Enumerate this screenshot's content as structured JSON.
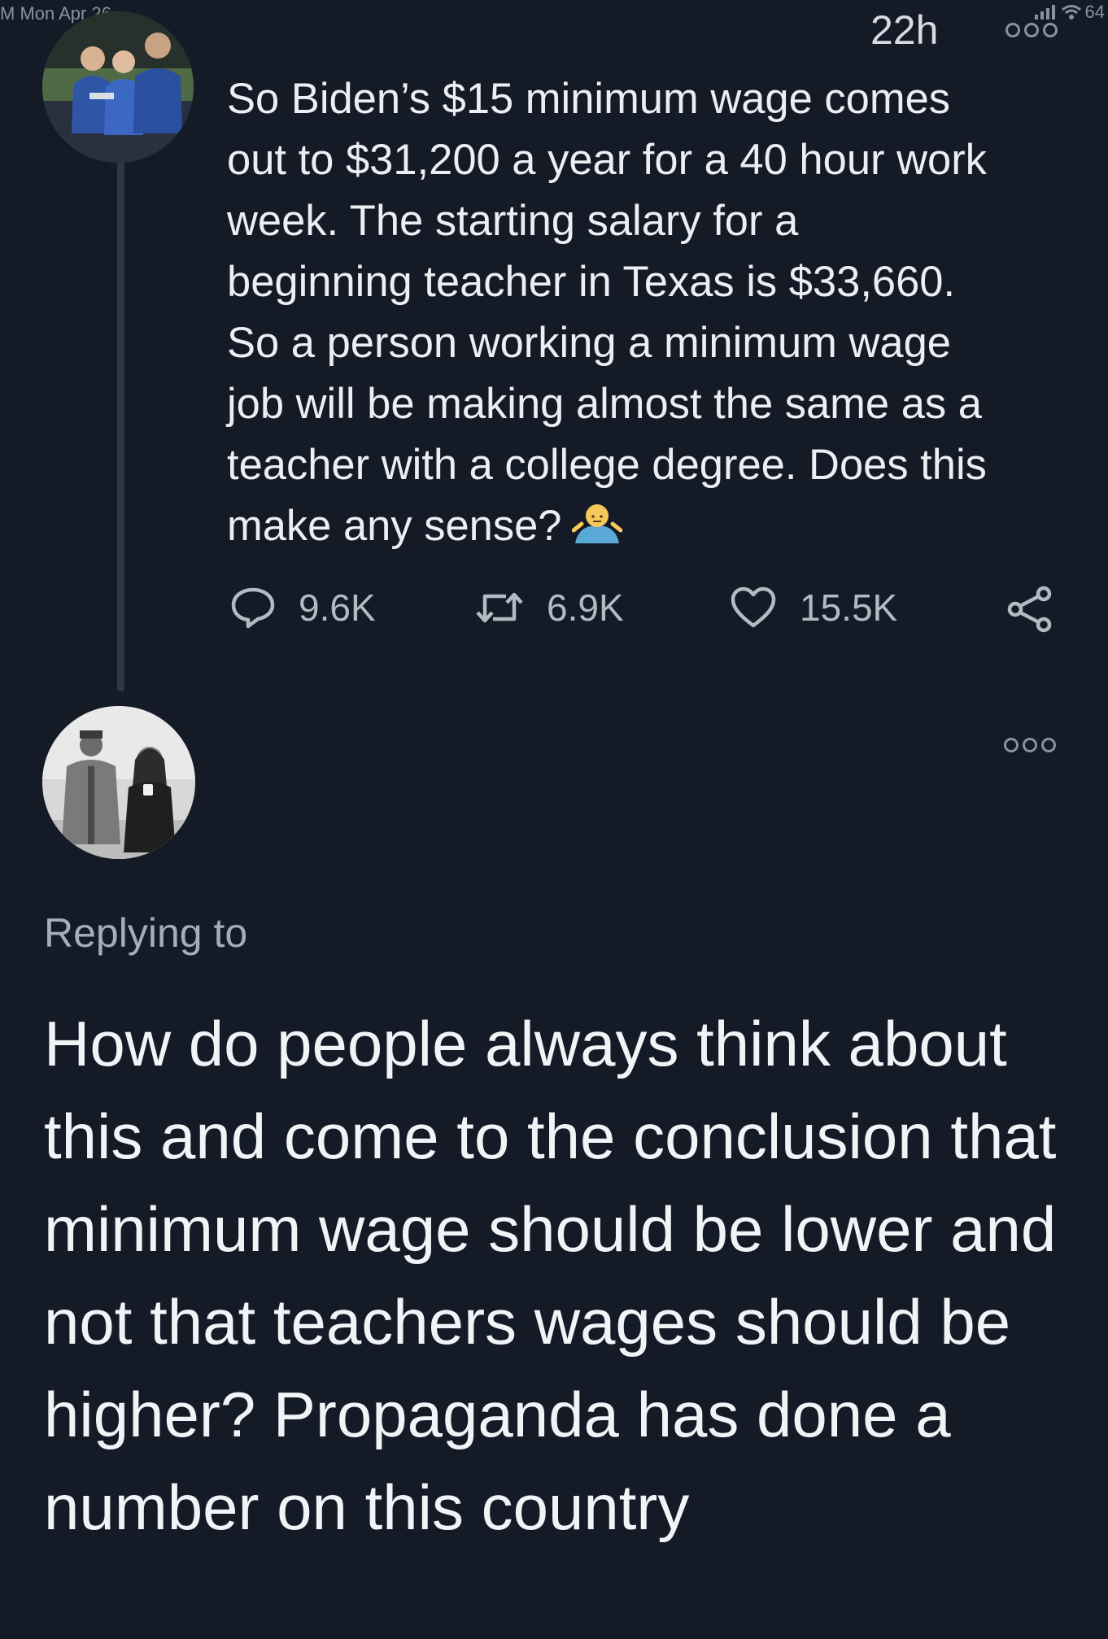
{
  "status_bar": {
    "left_text": "M   Mon Apr 26",
    "battery_text": "64"
  },
  "original_tweet": {
    "time": "22h",
    "more_icon": "ellipsis-circles-icon",
    "text": "So Biden’s $15 minimum wage comes\nout to $31,200 a year for a 40 hour work\nweek. The starting salary for a\nbeginning teacher in Texas is $33,660.\nSo a person working a minimum wage\njob will be making almost the same as a\nteacher with a college degree. Does this\nmake any sense?",
    "emoji": "person-shrugging-emoji",
    "actions": {
      "replies": "9.6K",
      "retweets": "6.9K",
      "likes": "15.5K"
    }
  },
  "reply_tweet": {
    "more_icon": "ellipsis-circles-icon",
    "replying_to": "Replying to",
    "text": "How do people always think about this and come to the conclusion that minimum wage should be lower and not that teachers wages should be higher? Propaganda has done a number on this country"
  },
  "colors": {
    "background": "#151b26",
    "text": "#ebeef2",
    "muted": "#b4bac3",
    "thread_line": "#2f3744"
  }
}
